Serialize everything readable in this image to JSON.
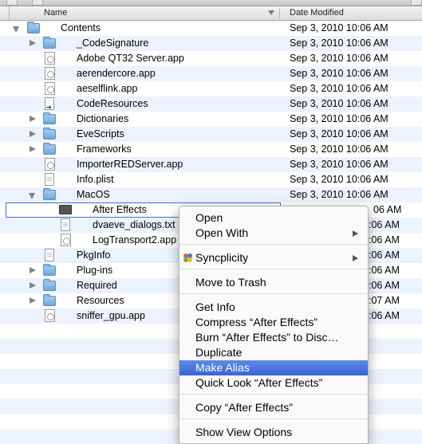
{
  "header": {
    "name_label": "Name",
    "date_label": "Date Modified"
  },
  "rows": [
    {
      "name": "Contents",
      "date": "Sep 3, 2010 10:06 AM",
      "icon": "folder-icon",
      "disclosure": "open"
    },
    {
      "name": "_CodeSignature",
      "date": "Sep 3, 2010 10:06 AM",
      "icon": "folder-icon",
      "disclosure": "closed"
    },
    {
      "name": "Adobe QT32 Server.app",
      "date": "Sep 3, 2010 10:06 AM",
      "icon": "app-icon",
      "disclosure": "none"
    },
    {
      "name": "aerendercore.app",
      "date": "Sep 3, 2010 10:06 AM",
      "icon": "app-icon",
      "disclosure": "none"
    },
    {
      "name": "aeselflink.app",
      "date": "Sep 3, 2010 10:06 AM",
      "icon": "app-icon",
      "disclosure": "none"
    },
    {
      "name": "CodeResources",
      "date": "Sep 3, 2010 10:06 AM",
      "icon": "executable-icon",
      "disclosure": "none"
    },
    {
      "name": "Dictionaries",
      "date": "Sep 3, 2010 10:06 AM",
      "icon": "folder-icon",
      "disclosure": "closed"
    },
    {
      "name": "EveScripts",
      "date": "Sep 3, 2010 10:06 AM",
      "icon": "folder-icon",
      "disclosure": "closed"
    },
    {
      "name": "Frameworks",
      "date": "Sep 3, 2010 10:06 AM",
      "icon": "folder-icon",
      "disclosure": "closed"
    },
    {
      "name": "ImporterREDServer.app",
      "date": "Sep 3, 2010 10:06 AM",
      "icon": "app-icon",
      "disclosure": "none"
    },
    {
      "name": "Info.plist",
      "date": "Sep 3, 2010 10:06 AM",
      "icon": "document-icon",
      "disclosure": "none"
    },
    {
      "name": "MacOS",
      "date": "Sep 3, 2010 10:06 AM",
      "icon": "folder-icon",
      "disclosure": "open"
    },
    {
      "name": "After Effects",
      "date": "",
      "icon": "terminal-icon",
      "disclosure": "none"
    },
    {
      "name": "dvaeve_dialogs.txt",
      "date": ":06 AM",
      "icon": "document-icon",
      "disclosure": "none"
    },
    {
      "name": "LogTransport2.app",
      "date": ":06 AM",
      "icon": "app-icon",
      "disclosure": "none"
    },
    {
      "name": "PkgInfo",
      "date": ":06 AM",
      "icon": "document-icon",
      "disclosure": "none"
    },
    {
      "name": "Plug-ins",
      "date": ":06 AM",
      "icon": "folder-icon",
      "disclosure": "closed"
    },
    {
      "name": "Required",
      "date": ":06 AM",
      "icon": "folder-icon",
      "disclosure": "closed"
    },
    {
      "name": "Resources",
      "date": ":07 AM",
      "icon": "folder-icon",
      "disclosure": "closed"
    },
    {
      "name": "sniffer_gpu.app",
      "date": ":06 AM",
      "icon": "app-icon",
      "disclosure": "none"
    }
  ],
  "row_under_menu_date": "06 AM",
  "context_menu": {
    "items": [
      {
        "label": "Open"
      },
      {
        "label": "Open With"
      },
      {
        "label": "Syncplicity"
      },
      {
        "label": "Move to Trash"
      },
      {
        "label": "Get Info"
      },
      {
        "label": "Compress “After Effects”"
      },
      {
        "label": "Burn “After Effects” to Disc…"
      },
      {
        "label": "Duplicate"
      },
      {
        "label": "Make Alias"
      },
      {
        "label": "Quick Look “After Effects”"
      },
      {
        "label": "Copy “After Effects”"
      },
      {
        "label": "Show View Options"
      }
    ],
    "highlighted": "Make Alias",
    "highlight_color": "#3b63d6"
  }
}
